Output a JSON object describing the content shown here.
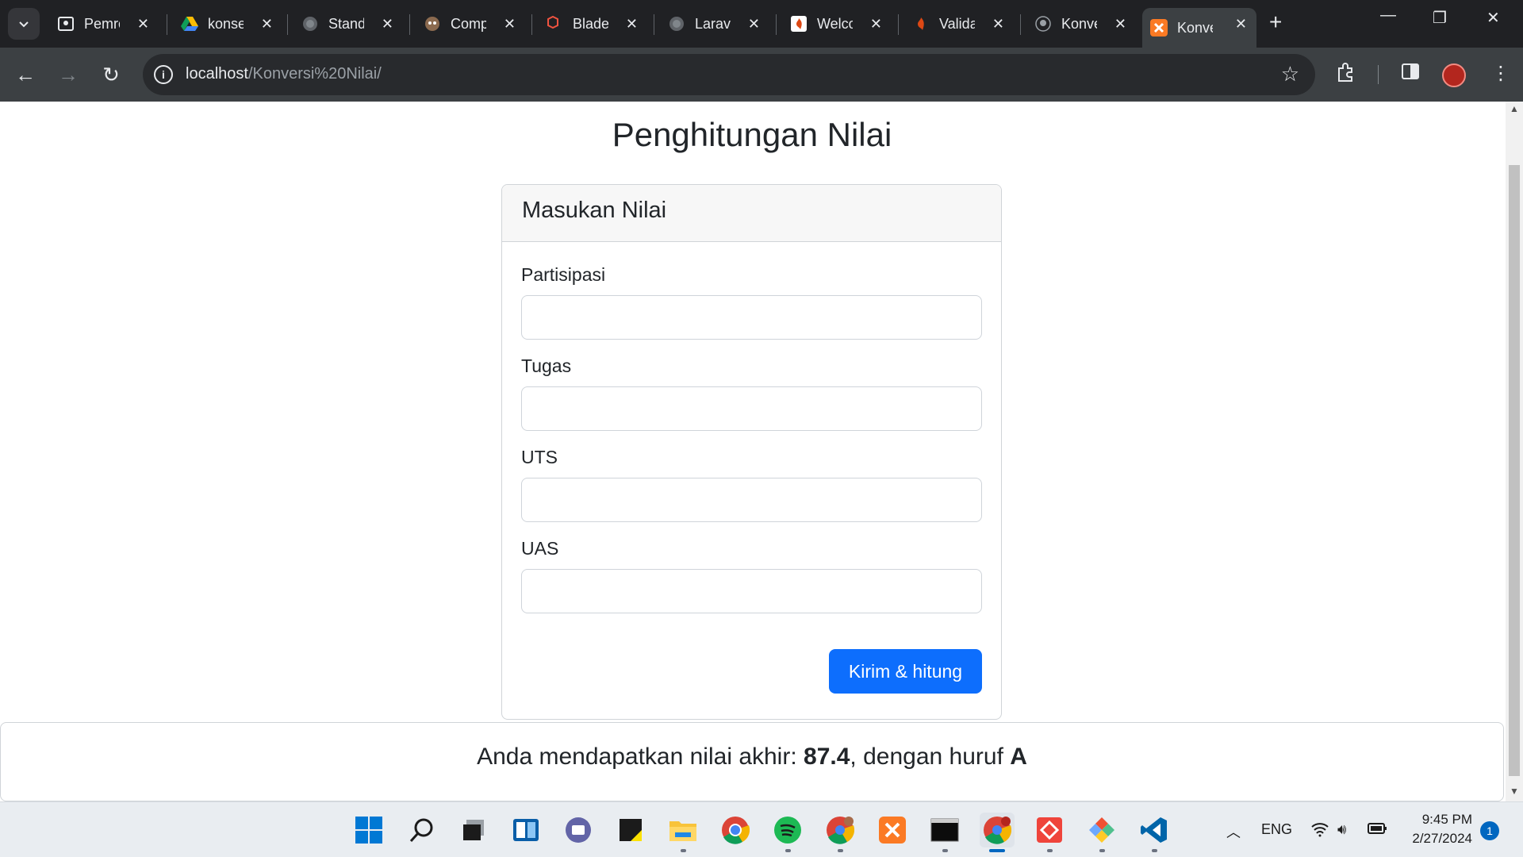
{
  "browser": {
    "tabs": [
      {
        "title": "Pemro",
        "icon": "contact-card-icon"
      },
      {
        "title": "konse",
        "icon": "google-drive-icon"
      },
      {
        "title": "Stand",
        "icon": "globe-icon"
      },
      {
        "title": "Comp",
        "icon": "composer-icon"
      },
      {
        "title": "Blade",
        "icon": "laravel-icon"
      },
      {
        "title": "Larave",
        "icon": "globe-icon"
      },
      {
        "title": "Welco",
        "icon": "codeigniter-icon"
      },
      {
        "title": "Valida",
        "icon": "codeigniter-icon"
      },
      {
        "title": "Konve",
        "icon": "github-icon"
      },
      {
        "title": "Konve",
        "icon": "xampp-icon",
        "active": true
      }
    ],
    "url_host": "localhost",
    "url_path": "/Konversi%20Nilai/"
  },
  "page": {
    "title": "Penghitungan Nilai",
    "card_header": "Masukan Nilai",
    "fields": [
      {
        "label": "Partisipasi",
        "value": ""
      },
      {
        "label": "Tugas",
        "value": ""
      },
      {
        "label": "UTS",
        "value": ""
      },
      {
        "label": "UAS",
        "value": ""
      }
    ],
    "submit_label": "Kirim & hitung",
    "result": {
      "prefix": "Anda mendapatkan nilai akhir: ",
      "score": "87.4",
      "middle": ", dengan huruf ",
      "grade": "A"
    }
  },
  "taskbar": {
    "language": "ENG",
    "time": "9:45 PM",
    "date": "2/27/2024",
    "notification_count": "1"
  },
  "colors": {
    "primary_button": "#0d6efd",
    "chrome_dark": "#202124"
  }
}
